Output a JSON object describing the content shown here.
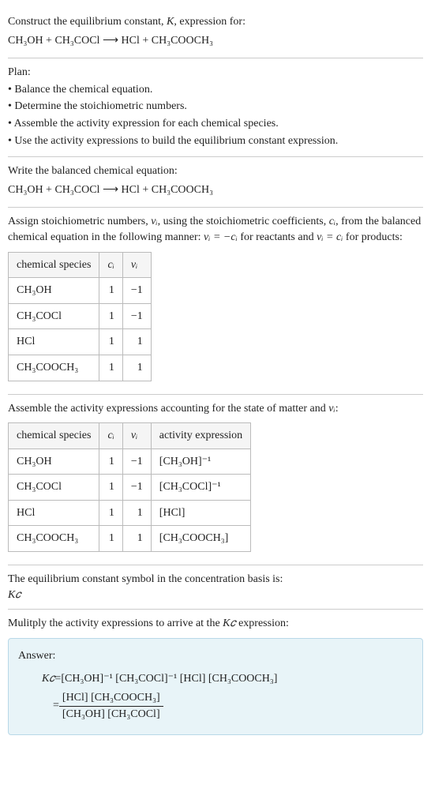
{
  "intro": {
    "construct_label": "Construct the equilibrium constant, ",
    "k_label": "K",
    "expression_for": ", expression for:",
    "equation_lhs": "CH₃OH + CH₃COCl",
    "arrow": " ⟶ ",
    "equation_rhs": "HCl + CH₃COOCH₃"
  },
  "plan": {
    "title": "Plan:",
    "items": [
      "• Balance the chemical equation.",
      "• Determine the stoichiometric numbers.",
      "• Assemble the activity expression for each chemical species.",
      "• Use the activity expressions to build the equilibrium constant expression."
    ]
  },
  "balanced": {
    "title": "Write the balanced chemical equation:",
    "equation_lhs": "CH₃OH + CH₃COCl",
    "arrow": " ⟶ ",
    "equation_rhs": "HCl + CH₃COOCH₃"
  },
  "stoich": {
    "intro1": "Assign stoichiometric numbers, ",
    "nu": "νᵢ",
    "intro2": ", using the stoichiometric coefficients, ",
    "ci": "cᵢ",
    "intro3": ", from the balanced chemical equation in the following manner: ",
    "rule1": "νᵢ = −cᵢ",
    "intro4": " for reactants and ",
    "rule2": "νᵢ = cᵢ",
    "intro5": " for products:",
    "headers": [
      "chemical species",
      "cᵢ",
      "νᵢ"
    ],
    "rows": [
      {
        "species": "CH₃OH",
        "ci": "1",
        "nu": "−1"
      },
      {
        "species": "CH₃COCl",
        "ci": "1",
        "nu": "−1"
      },
      {
        "species": "HCl",
        "ci": "1",
        "nu": "1"
      },
      {
        "species": "CH₃COOCH₃",
        "ci": "1",
        "nu": "1"
      }
    ]
  },
  "activity": {
    "intro1": "Assemble the activity expressions accounting for the state of matter and ",
    "nu": "νᵢ",
    "intro2": ":",
    "headers": [
      "chemical species",
      "cᵢ",
      "νᵢ",
      "activity expression"
    ],
    "rows": [
      {
        "species": "CH₃OH",
        "ci": "1",
        "nu": "−1",
        "expr": "[CH₃OH]⁻¹"
      },
      {
        "species": "CH₃COCl",
        "ci": "1",
        "nu": "−1",
        "expr": "[CH₃COCl]⁻¹"
      },
      {
        "species": "HCl",
        "ci": "1",
        "nu": "1",
        "expr": "[HCl]"
      },
      {
        "species": "CH₃COOCH₃",
        "ci": "1",
        "nu": "1",
        "expr": "[CH₃COOCH₃]"
      }
    ]
  },
  "constant": {
    "text": "The equilibrium constant symbol in the concentration basis is:",
    "symbol": "K𝑐"
  },
  "multiply": {
    "text1": "Mulitply the activity expressions to arrive at the ",
    "kc": "K𝑐",
    "text2": " expression:"
  },
  "answer": {
    "label": "Answer:",
    "kc": "K𝑐",
    "eq": " = ",
    "line1": "[CH₃OH]⁻¹ [CH₃COCl]⁻¹ [HCl] [CH₃COOCH₃]",
    "numerator": "[HCl] [CH₃COOCH₃]",
    "denominator": "[CH₃OH] [CH₃COCl]"
  }
}
